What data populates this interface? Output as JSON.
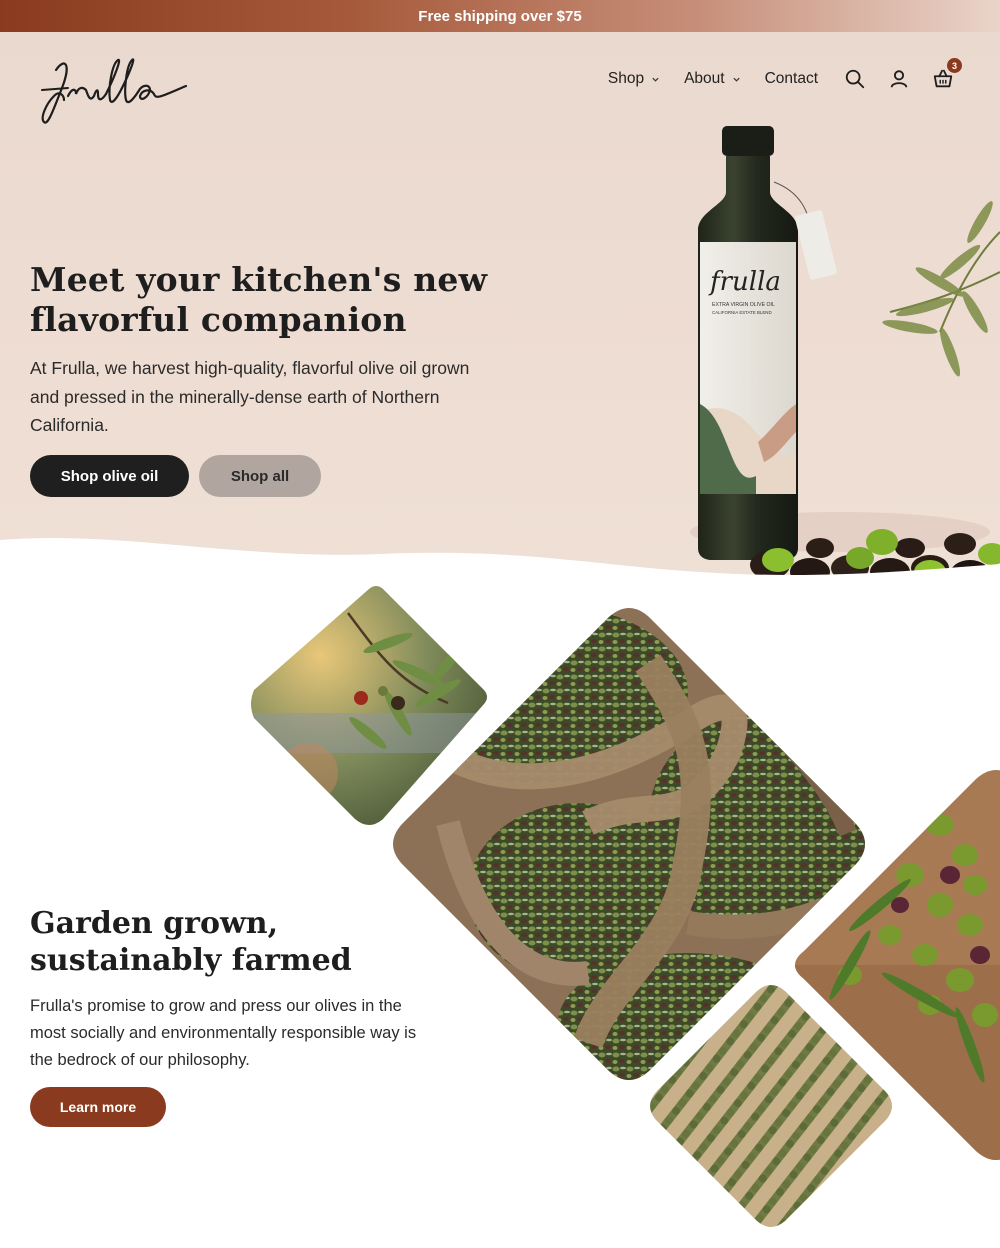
{
  "announcement": {
    "text": "Free shipping over $75"
  },
  "header": {
    "logo_text": "frulla",
    "nav": [
      {
        "label": "Shop",
        "has_dropdown": true
      },
      {
        "label": "About",
        "has_dropdown": true
      },
      {
        "label": "Contact",
        "has_dropdown": false
      }
    ],
    "icons": [
      "search-icon",
      "account-icon",
      "cart-icon"
    ],
    "cart_count": "3"
  },
  "hero": {
    "title": "Meet your kitchen's new flavorful companion",
    "text": "At Frulla, we harvest high-quality, flavorful olive oil grown and pressed in the minerally-dense earth of Northern California.",
    "primary_button": "Shop olive oil",
    "secondary_button": "Shop all",
    "bottle_label": {
      "brand": "frulla",
      "line1": "EXTRA VIRGIN OLIVE OIL",
      "line2": "CALIFORNIA ESTATE BLEND"
    }
  },
  "section2": {
    "title": "Garden grown, sustainably farmed",
    "text": "Frulla's promise to grow and press our olives in the most socially and environmentally responsible way is the bedrock of our philosophy.",
    "button": "Learn more"
  },
  "colors": {
    "accent": "#8a3b1f",
    "hero_bg": "#eddcd2",
    "dark_button": "#1f1f1f",
    "grey_button": "#b1a5a0"
  }
}
